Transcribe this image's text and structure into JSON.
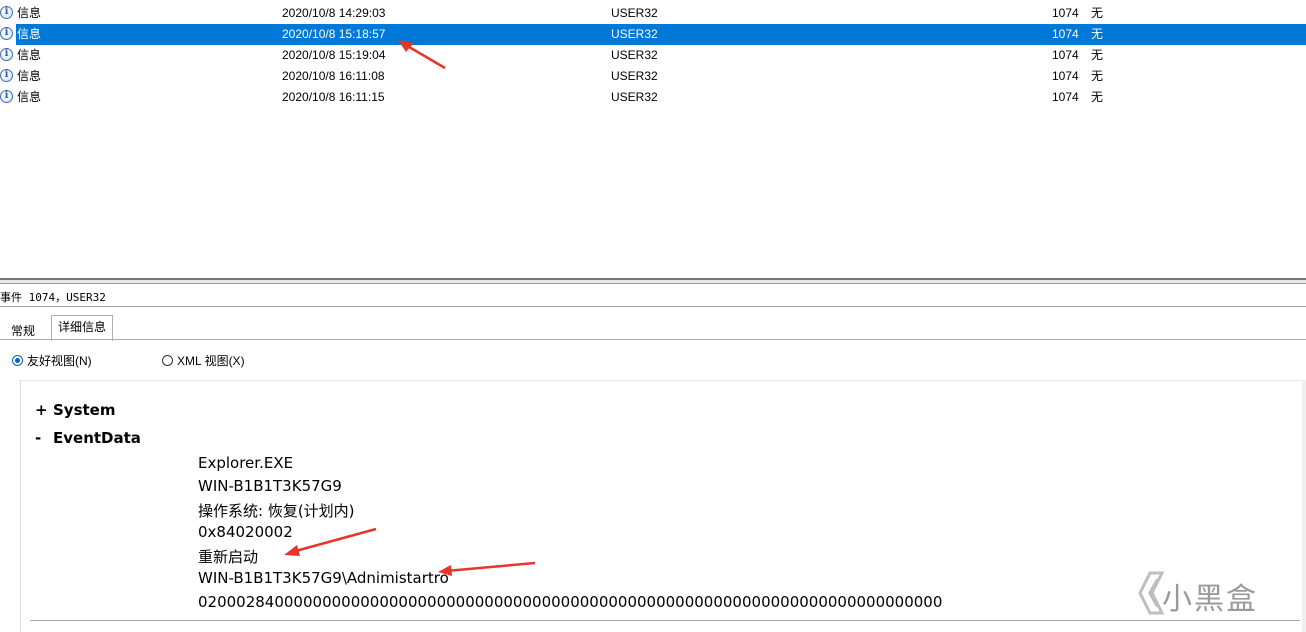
{
  "event_list": {
    "rows": [
      {
        "level": "信息",
        "date": "2020/10/8 14:29:03",
        "source": "USER32",
        "event_id": "1074",
        "task": "无",
        "selected": false
      },
      {
        "level": "信息",
        "date": "2020/10/8 15:18:57",
        "source": "USER32",
        "event_id": "1074",
        "task": "无",
        "selected": true
      },
      {
        "level": "信息",
        "date": "2020/10/8 15:19:04",
        "source": "USER32",
        "event_id": "1074",
        "task": "无",
        "selected": false
      },
      {
        "level": "信息",
        "date": "2020/10/8 16:11:08",
        "source": "USER32",
        "event_id": "1074",
        "task": "无",
        "selected": false
      },
      {
        "level": "信息",
        "date": "2020/10/8 16:11:15",
        "source": "USER32",
        "event_id": "1074",
        "task": "无",
        "selected": false
      }
    ]
  },
  "detail": {
    "caption": "事件 1074，USER32",
    "tabs": [
      "常规",
      "详细信息"
    ],
    "active_tab": "详细信息",
    "view_options": {
      "friendly": "友好视图(N)",
      "xml": "XML 视图(X)",
      "selected": "friendly"
    },
    "sections": {
      "system": {
        "toggle": "+",
        "label": "System"
      },
      "eventdata": {
        "toggle": "-",
        "label": "EventData"
      }
    },
    "event_data": [
      "Explorer.EXE",
      "WIN-B1B1T3K57G9",
      "操作系统: 恢复(计划内)",
      "0x84020002",
      "重新启动",
      "WIN-B1B1T3K57G9\\Adnimistartro",
      "020002840000000000000000000000000000000000000000000000000000000000000000000000"
    ]
  },
  "watermark": {
    "text": "小黑盒"
  },
  "colors": {
    "selection": "#0078d7",
    "annotation_arrow": "#e8352a"
  },
  "icons": {
    "row_level": "info-icon",
    "watermark_logo": "heybox-logo-icon"
  }
}
